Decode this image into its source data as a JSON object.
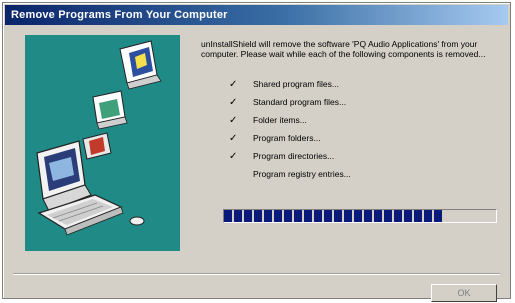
{
  "window": {
    "title": "Remove Programs From Your Computer"
  },
  "message": "unInstallShield will remove the software 'PQ Audio Applications' from your computer. Please wait while each of the following components is removed...",
  "steps": [
    {
      "label": "Shared program files...",
      "done": true
    },
    {
      "label": "Standard program files...",
      "done": true
    },
    {
      "label": "Folder items...",
      "done": true
    },
    {
      "label": "Program folders...",
      "done": true
    },
    {
      "label": "Program directories...",
      "done": true
    },
    {
      "label": "Program registry entries...",
      "done": false
    }
  ],
  "check_glyph": "✓",
  "progress": {
    "fraction": 0.8,
    "color": "#0a1a7a"
  },
  "ok_button": {
    "label": "OK",
    "enabled": false
  },
  "illustration": {
    "background": "#1f8a86",
    "icons": [
      "computer-icon",
      "folder-icon",
      "document-icon",
      "trash-icon"
    ]
  }
}
